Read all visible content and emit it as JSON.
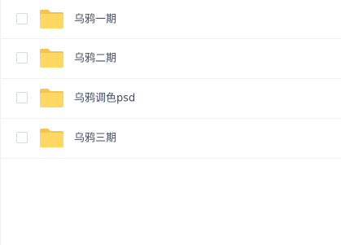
{
  "file_list": {
    "items": [
      {
        "name": "乌鸦一期",
        "type": "folder",
        "icon": "folder-icon"
      },
      {
        "name": "乌鸦二期",
        "type": "folder",
        "icon": "folder-icon"
      },
      {
        "name": "乌鸦调色psd",
        "type": "folder",
        "icon": "folder-icon"
      },
      {
        "name": "乌鸦三期",
        "type": "folder",
        "icon": "folder-icon"
      }
    ]
  },
  "colors": {
    "folder": "#ffd763",
    "folder_tab": "#f5c44e",
    "text": "#424e67",
    "divider": "#f1f2f4",
    "checkbox_border": "#d7dbe1"
  }
}
